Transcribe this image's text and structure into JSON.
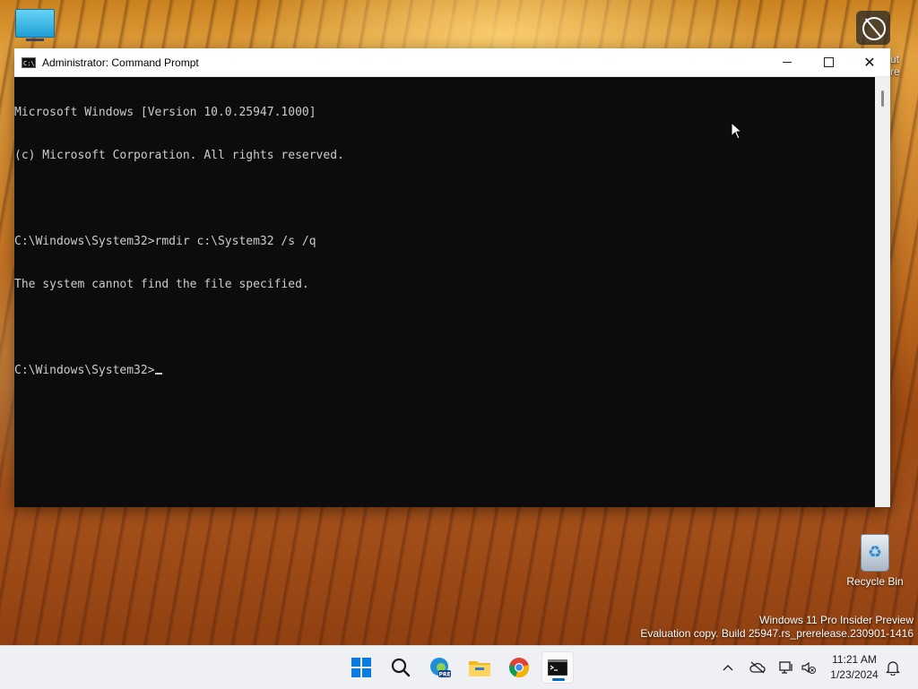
{
  "desktop": {
    "side_text_lines": [
      "ut",
      "re"
    ],
    "recycle_bin_label": "Recycle Bin",
    "watermark": {
      "line1": "Windows 11 Pro Insider Preview",
      "line2": "Evaluation copy. Build 25947.rs_prerelease.230901-1416"
    }
  },
  "window": {
    "title": "Administrator: Command Prompt",
    "icon_text": "C:\\.",
    "console_lines": [
      "Microsoft Windows [Version 10.0.25947.1000]",
      "(c) Microsoft Corporation. All rights reserved.",
      "",
      "C:\\Windows\\System32>rmdir c:\\System32 /s /q",
      "The system cannot find the file specified.",
      "",
      "C:\\Windows\\System32>"
    ]
  },
  "taskbar": {
    "apps": [
      {
        "name": "start-button",
        "icon": "windows-logo"
      },
      {
        "name": "search-button",
        "icon": "search-icon"
      },
      {
        "name": "edge-preview-button",
        "icon": "edge-beta-icon",
        "badge": "PRE"
      },
      {
        "name": "file-explorer-button",
        "icon": "folder-icon"
      },
      {
        "name": "chrome-button",
        "icon": "chrome-icon"
      },
      {
        "name": "command-prompt-button",
        "icon": "cmd-icon",
        "active": true
      }
    ],
    "clock": {
      "time": "11:21 AM",
      "date": "1/23/2024"
    }
  },
  "colors": {
    "accent": "#0067c0",
    "console_bg": "#0c0c0c",
    "console_fg": "#cccccc",
    "taskbar_bg": "#eef0f3"
  }
}
